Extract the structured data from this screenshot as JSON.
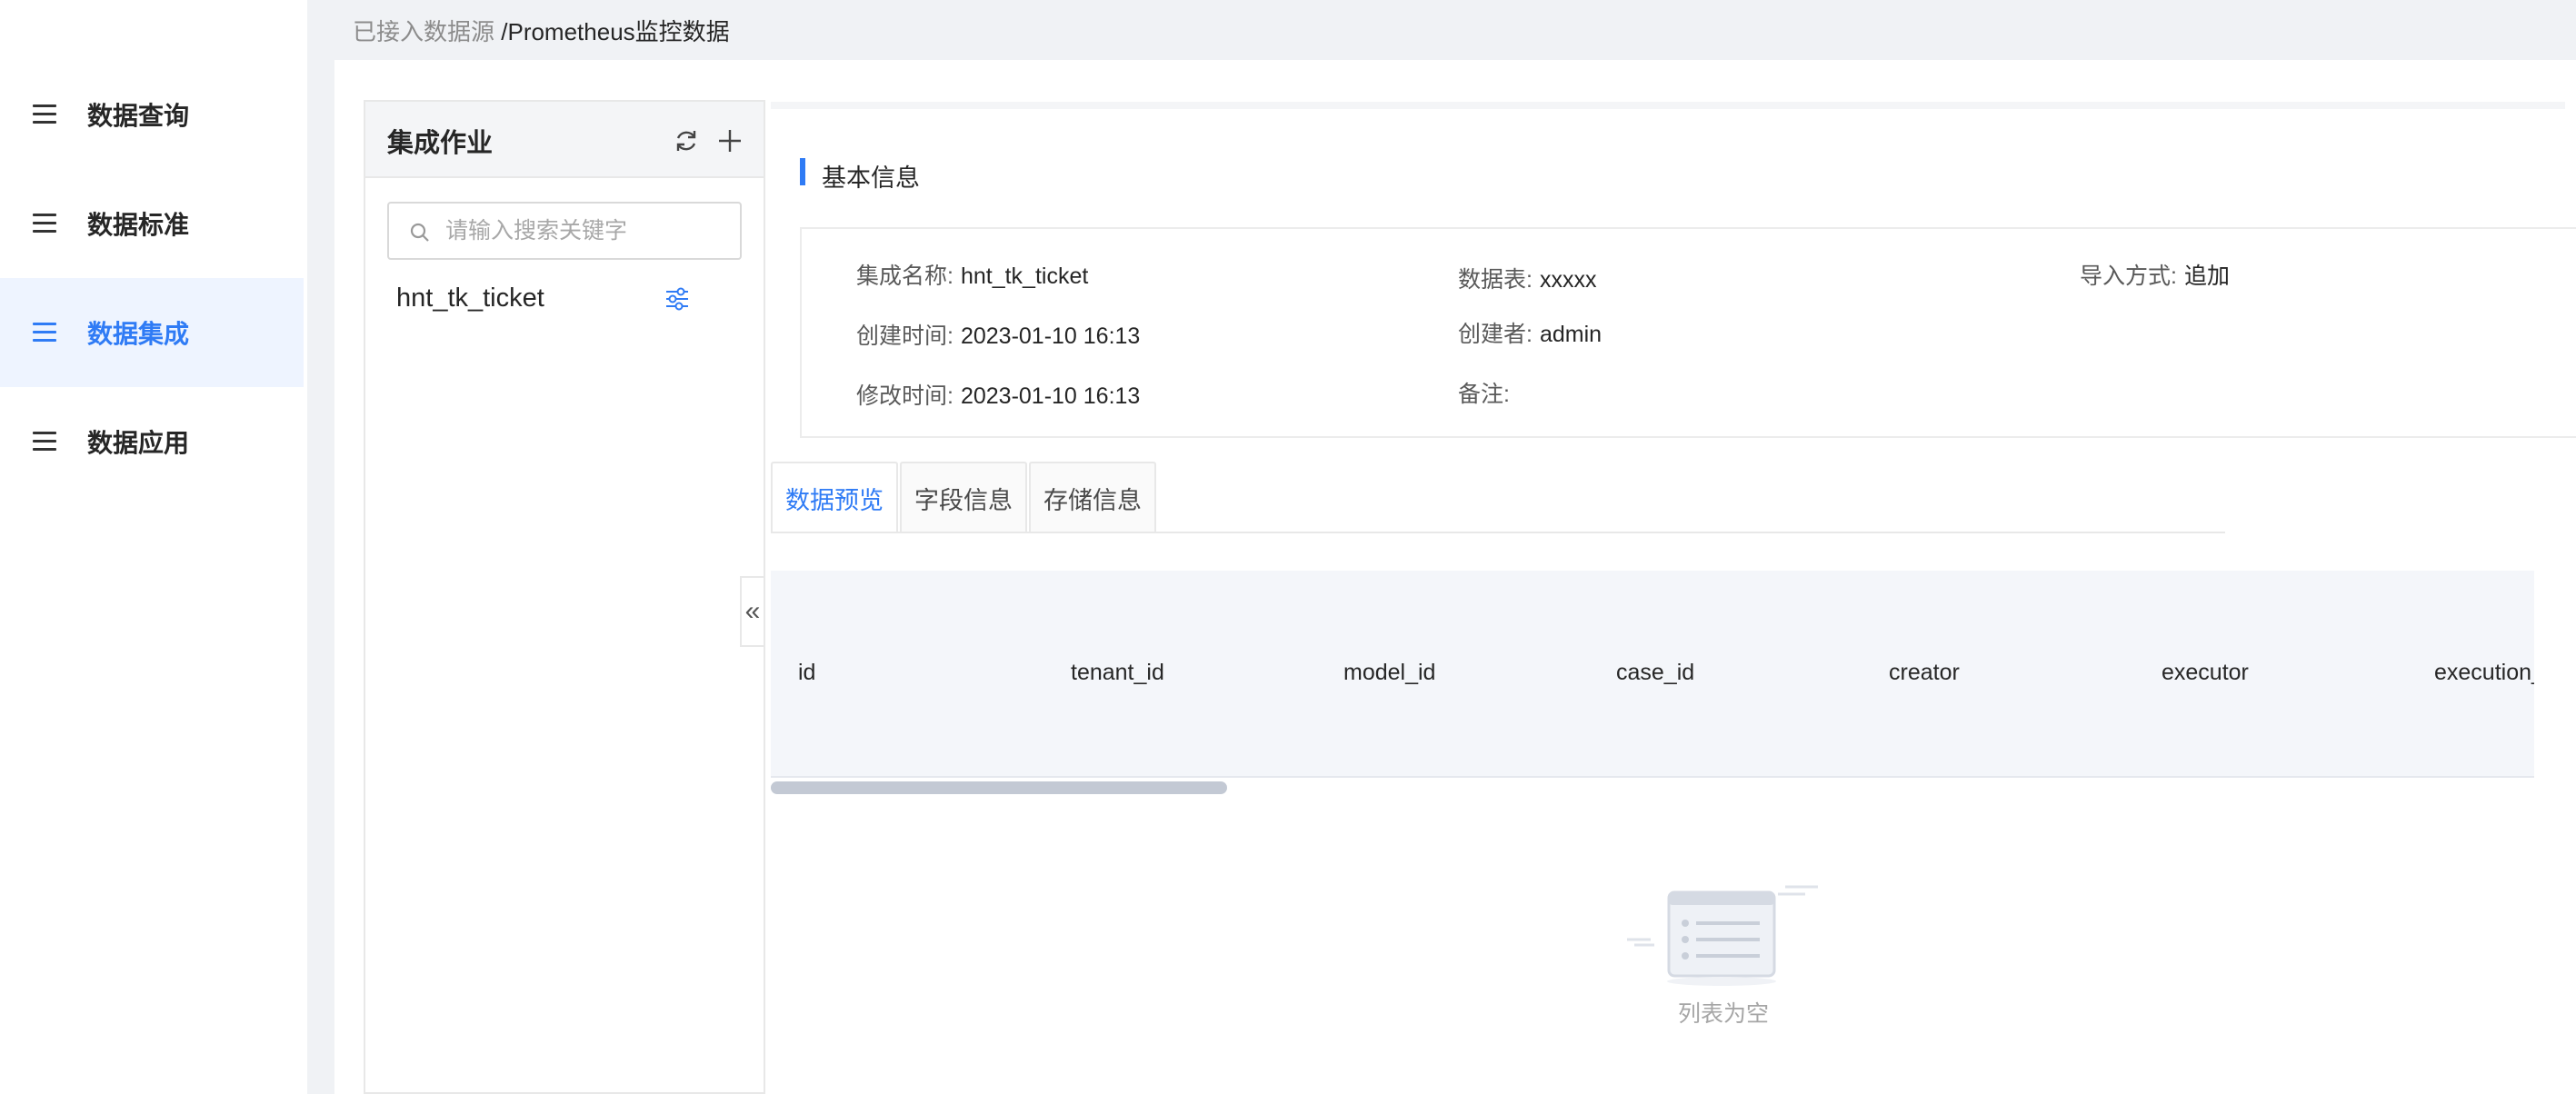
{
  "sidebar": {
    "items": [
      {
        "label": "数据查询",
        "active": false
      },
      {
        "label": "数据标准",
        "active": false
      },
      {
        "label": "数据集成",
        "active": true
      },
      {
        "label": "数据应用",
        "active": false
      }
    ]
  },
  "breadcrumb": {
    "parent": "已接入数据源",
    "current": "/Prometheus监控数据"
  },
  "jobs_panel": {
    "title": "集成作业",
    "search_placeholder": "请输入搜索关键字",
    "items": [
      "hnt_tk_ticket"
    ]
  },
  "basic_info": {
    "title": "基本信息",
    "fields": {
      "name_label": "集成名称:",
      "name_value": "hnt_tk_ticket",
      "table_label": "数据表:",
      "table_value": "xxxxx",
      "import_label": "导入方式:",
      "import_value": "追加",
      "created_label": "创建时间:",
      "created_value": "2023-01-10 16:13",
      "creator_label": "创建者:",
      "creator_value": "admin",
      "modified_label": "修改时间:",
      "modified_value": "2023-01-10 16:13",
      "remark_label": "备注:",
      "remark_value": ""
    }
  },
  "tabs": [
    {
      "label": "数据预览",
      "active": true
    },
    {
      "label": "字段信息",
      "active": false
    },
    {
      "label": "存储信息",
      "active": false
    }
  ],
  "table": {
    "columns": [
      "id",
      "tenant_id",
      "model_id",
      "case_id",
      "creator",
      "executor",
      "execution_"
    ],
    "empty_text": "列表为空"
  },
  "colors": {
    "accent": "#2f7bf5",
    "active_bg": "#eef4ff",
    "page_bg": "#f0f2f5"
  }
}
